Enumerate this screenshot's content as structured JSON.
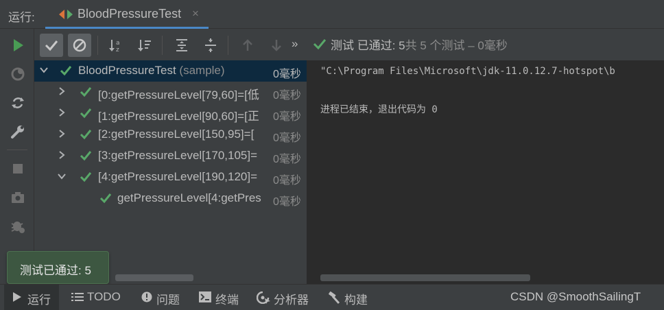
{
  "header": {
    "run_label": "运行:",
    "tab_title": "BloodPressureTest",
    "close_glyph": "×"
  },
  "toolbar": {
    "more_glyph": "»",
    "status_prefix": "测试 已通过: 5",
    "status_suffix": "共 5 个测试 – 0毫秒"
  },
  "tree": {
    "rows": [
      {
        "label": "BloodPressureTest",
        "suffix": "(sample)",
        "time": "0毫秒",
        "state": "expanded"
      },
      {
        "label": "[0:getPressureLevel[79,60]=[低",
        "suffix": "",
        "time": "0毫秒",
        "state": "collapsed"
      },
      {
        "label": "[1:getPressureLevel[90,60]=[正",
        "suffix": "",
        "time": "0毫秒",
        "state": "collapsed"
      },
      {
        "label": "[2:getPressureLevel[150,95]=[",
        "suffix": "",
        "time": "0毫秒",
        "state": "collapsed"
      },
      {
        "label": "[3:getPressureLevel[170,105]=",
        "suffix": "",
        "time": "0毫秒",
        "state": "collapsed"
      },
      {
        "label": "[4:getPressureLevel[190,120]=",
        "suffix": "",
        "time": "0毫秒",
        "state": "expanded"
      },
      {
        "label": "getPressureLevel[4:getPres",
        "suffix": "",
        "time": "0毫秒",
        "state": "leaf"
      }
    ]
  },
  "console": {
    "line1": "\"C:\\Program Files\\Microsoft\\jdk-11.0.12.7-hotspot\\b",
    "line2": "进程已结束，退出代码为 0"
  },
  "tooltip": {
    "text": "测试已通过: 5"
  },
  "bottombar": {
    "run": "运行",
    "todo": "TODO",
    "problems": "问题",
    "terminal": "终端",
    "profiler": "分析器",
    "build": "构建",
    "watermark": "CSDN @SmoothSailingT"
  },
  "colors": {
    "pass_green": "#59a869",
    "run_green": "#499c54",
    "selection": "#0d293e",
    "accent_tab": "#4a88c7"
  },
  "icons": [
    "run-icon",
    "rerun-failed-icon",
    "toggle-auto-test-icon",
    "wrench-icon",
    "stop-icon",
    "camera-icon",
    "bug-settings-icon",
    "check-icon",
    "ban-icon",
    "sort-alpha-icon",
    "sort-duration-icon",
    "expand-all-icon",
    "collapse-all-icon",
    "arrow-up-icon",
    "arrow-down-icon"
  ]
}
